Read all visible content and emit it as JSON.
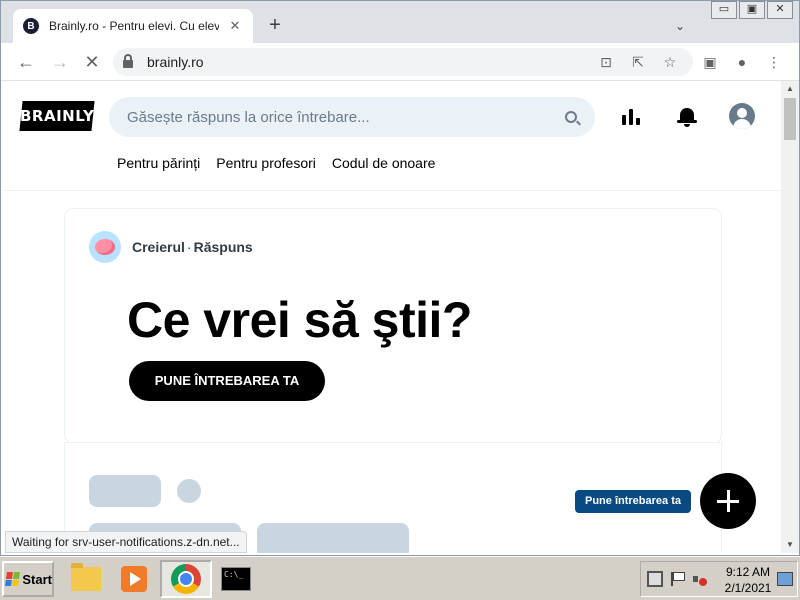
{
  "browser": {
    "tab_title": "Brainly.ro - Pentru elevi. Cu elevi.",
    "tab_close": "✕",
    "new_tab": "+",
    "url": "brainly.ro",
    "window_controls": {
      "minimize": "▭",
      "maximize": "▣",
      "close": "✕"
    }
  },
  "site": {
    "logo_text": "BRAINLY",
    "search_placeholder": "Găsește răspuns la orice întrebare...",
    "nav": [
      "Pentru părinți",
      "Pentru profesori",
      "Codul de onoare"
    ]
  },
  "hero": {
    "author_name": "Creierul",
    "author_sep": "·",
    "author_role": "Răspuns",
    "headline": "Ce vrei să ştii?",
    "ask_button": "PUNE ÎNTREBAREA TA"
  },
  "fab": {
    "tooltip": "Pune întrebarea ta"
  },
  "status_text": "Waiting for srv-user-notifications.z-dn.net...",
  "taskbar": {
    "start_label": "Start",
    "time": "9:12 AM",
    "date": "2/1/2021"
  },
  "colors": {
    "accent_dark": "#000000",
    "search_bg": "#ebf2f7",
    "tooltip_bg": "#0a4a83",
    "skeleton": "#c9d5e0"
  },
  "icons": [
    "brainly-favicon",
    "search-icon",
    "stats-icon",
    "bell-icon",
    "user-avatar-icon",
    "brain-avatar-icon",
    "plus-icon",
    "windows-flag-icon",
    "folder-icon",
    "media-player-icon",
    "chrome-icon",
    "cmd-icon"
  ]
}
